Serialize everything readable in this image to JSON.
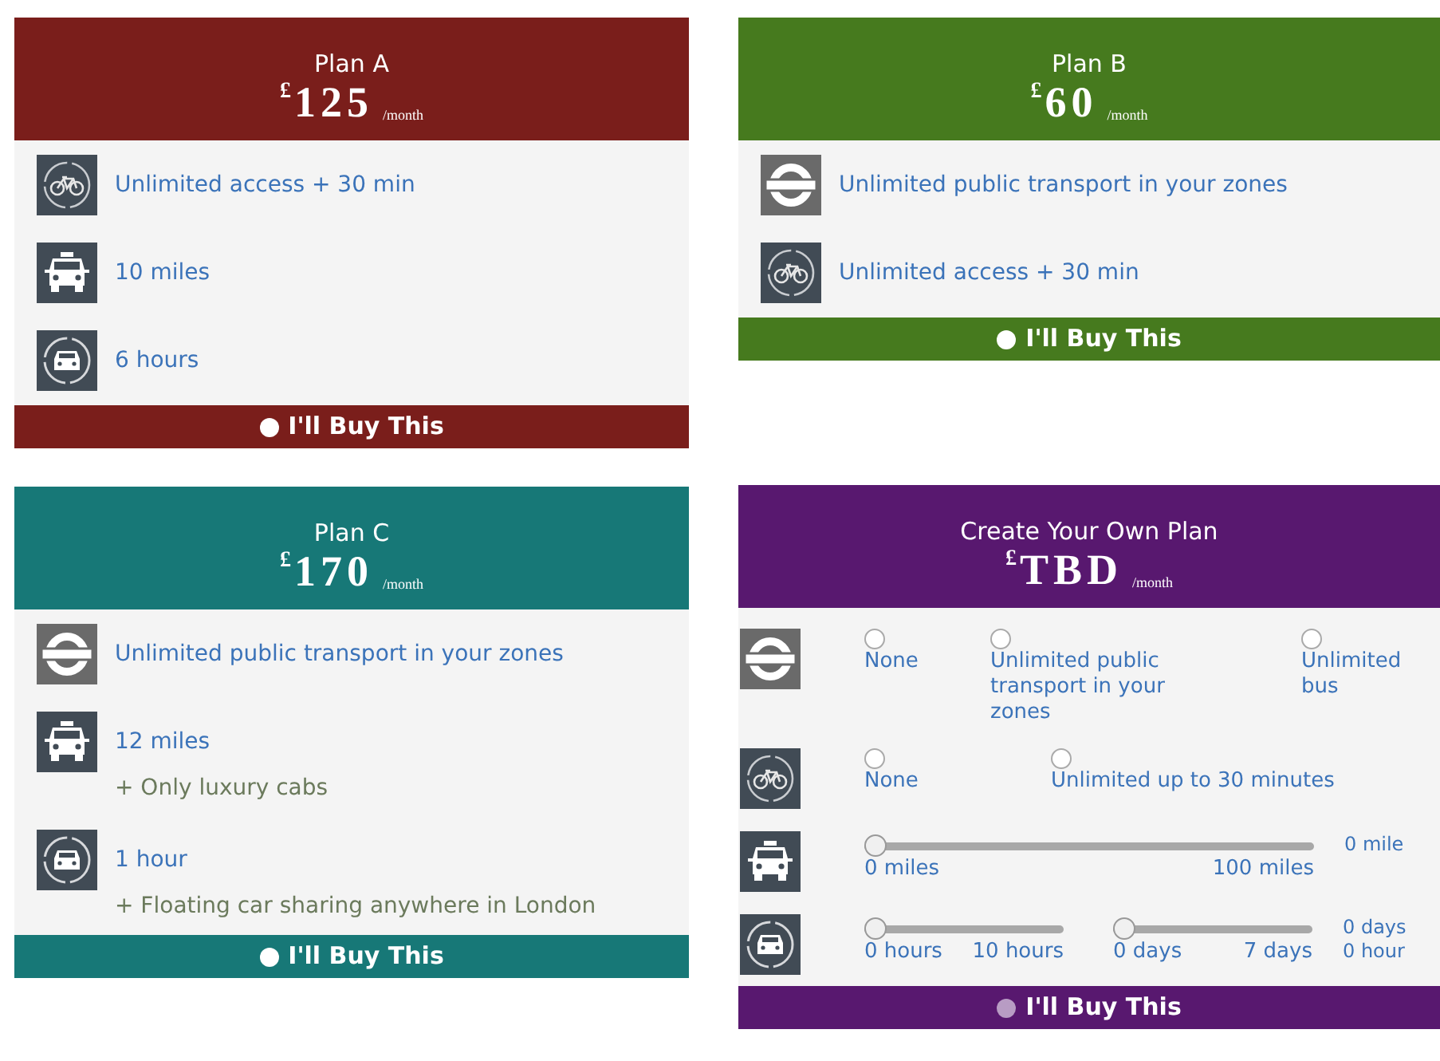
{
  "plans": [
    {
      "title": "Plan A",
      "currency": "£",
      "price": "125",
      "period": "/month",
      "color": "#7a1e1b",
      "features": [
        {
          "kind": "bike",
          "text": "Unlimited access + 30 min"
        },
        {
          "kind": "taxi",
          "text": "10 miles"
        },
        {
          "kind": "carshare",
          "text": "6 hours"
        }
      ],
      "buy": {
        "label": "I'll Buy This",
        "selected": false,
        "disabled": false
      }
    },
    {
      "title": "Plan B",
      "currency": "£",
      "price": "60",
      "period": "/month",
      "color": "#467a1e",
      "features": [
        {
          "kind": "tube",
          "text": "Unlimited public transport in your zones"
        },
        {
          "kind": "bike",
          "text": "Unlimited access + 30 min"
        }
      ],
      "buy": {
        "label": "I'll Buy This",
        "selected": false,
        "disabled": false
      }
    },
    {
      "title": "Plan C",
      "currency": "£",
      "price": "170",
      "period": "/month",
      "color": "#177877",
      "features": [
        {
          "kind": "tube",
          "text": "Unlimited public transport in your zones"
        },
        {
          "kind": "taxi",
          "text": "12 miles",
          "note": "+ Only luxury cabs"
        },
        {
          "kind": "carshare",
          "text": "1 hour",
          "note": "+ Floating car sharing anywhere in London"
        }
      ],
      "buy": {
        "label": "I'll Buy This",
        "selected": false,
        "disabled": false
      }
    }
  ],
  "custom_plan": {
    "title": "Create Your Own Plan",
    "currency": "£",
    "price": "TBD",
    "period": "/month",
    "color": "#58186f",
    "rows": [
      {
        "kind": "tube_radio",
        "options": [
          {
            "label": "None",
            "selected": false
          },
          {
            "label": "Unlimited public transport in your zones",
            "selected": false
          },
          {
            "label": "Unlimited bus",
            "selected": false
          }
        ]
      },
      {
        "kind": "bike_radio",
        "options": [
          {
            "label": "None",
            "selected": false
          },
          {
            "label": "Unlimited up to 30 minutes",
            "selected": false
          }
        ]
      },
      {
        "kind": "taxi_slider",
        "sliders": [
          {
            "min_label": "0 miles",
            "max_label": "100 miles",
            "level": 0
          }
        ],
        "readings": [
          "0 mile"
        ]
      },
      {
        "kind": "carshare_slider",
        "sliders": [
          {
            "min_label": "0 hours",
            "max_label": "10 hours",
            "level": 0
          },
          {
            "min_label": "0 days",
            "max_label": "7 days",
            "level": 0
          }
        ],
        "readings": [
          "0 days",
          "0 hour"
        ]
      }
    ],
    "buy": {
      "label": "I'll Buy This",
      "selected": false,
      "disabled": true
    }
  }
}
